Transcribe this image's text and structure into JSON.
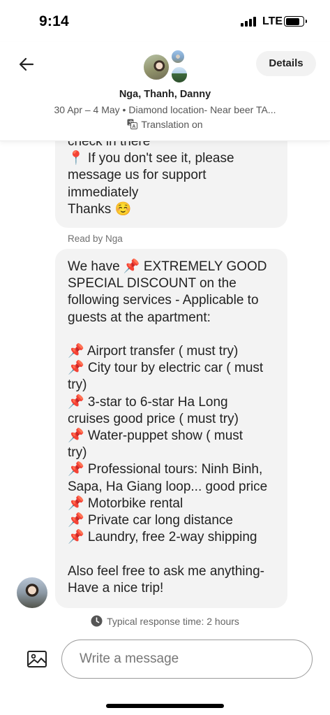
{
  "status_bar": {
    "time": "9:14",
    "network": "LTE"
  },
  "header": {
    "details_label": "Details",
    "names": "Nga, Thanh, Danny",
    "subline": "30 Apr – 4 May • Diamond location- Near beer TA...",
    "translation": "Translation on"
  },
  "messages": {
    "first_bubble_lines": [
      "check in there",
      "📍 If you don't see it, please",
      "message us for support",
      "immediately",
      "Thanks ☺️"
    ],
    "read_by": "Read by Nga",
    "second_bubble_lines": [
      "We have 📌 EXTREMELY GOOD",
      "SPECIAL DISCOUNT on the",
      "following services - Applicable to",
      "guests at the apartment:",
      "",
      "📌 Airport transfer ( must try)",
      "📌 City tour by electric car ( must",
      "try)",
      "📌 3-star to 6-star Ha Long",
      "cruises good price ( must try)",
      "📌 Water-puppet show ( must",
      "try)",
      "📌 Professional tours: Ninh Binh,",
      "Sapa, Ha Giang loop... good price",
      "📌 Motorbike rental",
      "📌 Private car long distance",
      "📌 Laundry, free 2-way shipping",
      "",
      "Also feel free to ask me anything-",
      "Have a nice trip!"
    ]
  },
  "response_time": "Typical response time: 2 hours",
  "composer": {
    "placeholder": "Write a message"
  },
  "icons": {
    "back": "arrow-left-icon",
    "translate": "translate-icon",
    "clock": "clock-icon",
    "photo": "image-icon"
  },
  "colors": {
    "bubble": "#f3f3f3",
    "text": "#222222",
    "muted": "#707070"
  }
}
